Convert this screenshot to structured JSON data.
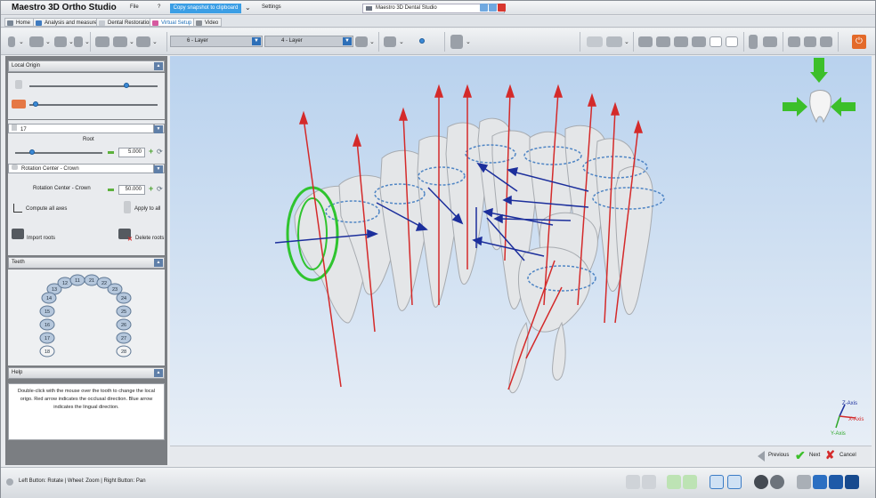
{
  "app": {
    "name": "Maestro 3D Ortho Studio",
    "window_title": "Maestro 3D Dental Studio"
  },
  "menu": {
    "file": "File",
    "help": "?",
    "snapshot": "Copy snapshot to clipboard",
    "settings": "Settings"
  },
  "tabs": [
    {
      "label": "Home"
    },
    {
      "label": "Analysis and measures"
    },
    {
      "label": "Dental Restoration"
    },
    {
      "label": "Virtual Setup"
    },
    {
      "label": "Video"
    }
  ],
  "toolbar": {
    "layer_a": "6 - Layer",
    "layer_b": "4 - Layer"
  },
  "left_panel": {
    "local_origin_title": "Local Origin",
    "tooth_number": "17",
    "root_label": "Root",
    "root_value": "5.000",
    "rotation_mode": "Rotation Center - Crown",
    "rotation_label": "Rotation Center - Crown",
    "rotation_value": "50.000",
    "compute_axes": "Compute all axes",
    "apply_all": "Apply to all",
    "import_roots": "Import roots",
    "delete_roots": "Delete roots",
    "teeth_title": "Teeth",
    "help_title": "Help",
    "help_text": "Double-click with the mouse over the tooth to change the local origo. Red arrow indicates the occlusal direction. Blue arrow indicates the lingual direction."
  },
  "teeth_chart": {
    "upper_right": [
      "13",
      "12",
      "11"
    ],
    "upper_left": [
      "21",
      "22",
      "23"
    ],
    "right_column": [
      "14",
      "15",
      "16",
      "17",
      "18"
    ],
    "left_column": [
      "24",
      "25",
      "26",
      "27",
      "28"
    ]
  },
  "viewport": {
    "axes": {
      "z": "Z-Axis",
      "x": "X-Axis",
      "y": "Y-Axis"
    }
  },
  "navigation": {
    "previous": "Previous",
    "next": "Next",
    "cancel": "Cancel"
  },
  "status": {
    "hint": "Left Button: Rotate | Wheel: Zoom | Right Button: Pan"
  },
  "colors": {
    "accent": "#3b9ee5",
    "occlusal_arrow": "#d42a2a",
    "lingual_arrow": "#1c2f9c",
    "selection_ring": "#2fc42f",
    "viewport_top": "#b9d2ee"
  }
}
